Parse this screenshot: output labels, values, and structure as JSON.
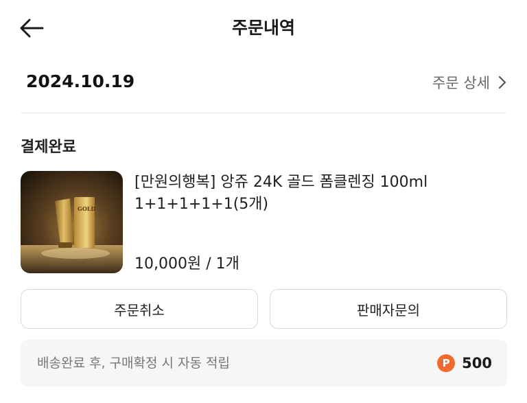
{
  "header": {
    "title": "주문내역"
  },
  "order": {
    "date": "2024.10.19",
    "detail_link": "주문 상세",
    "status": "결제완료"
  },
  "product": {
    "name": "[만원의행복] 앙쥬 24K 골드 폼클렌징 100ml 1+1+1+1+1(5개)",
    "price": "10,000원 / 1개",
    "image_label": "GOLD"
  },
  "actions": {
    "cancel_label": "주문취소",
    "seller_inquiry_label": "판매자문의"
  },
  "points": {
    "note": "배송완료 후, 구매확정 시 자동 적립",
    "badge": "P",
    "amount": "500"
  },
  "colors": {
    "accent": "#f26a2e",
    "divider": "#e8e8e8",
    "muted_text": "#777777"
  },
  "icons": {
    "back": "arrow-left-icon",
    "detail": "chevron-right-icon",
    "points": "point-badge-icon"
  }
}
